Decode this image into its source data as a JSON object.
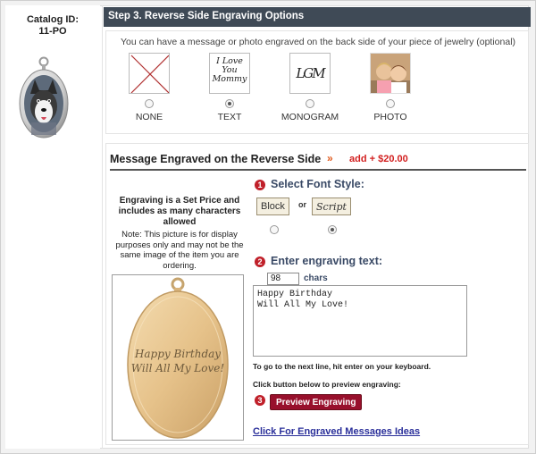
{
  "catalog": {
    "label": "Catalog ID:",
    "id": "11-PO"
  },
  "step3": {
    "title": "Step 3. Reverse Side Engraving Options",
    "intro": "You can have a message or photo engraved on the back side of your piece of jewelry (optional)",
    "options": [
      {
        "label": "NONE",
        "selected": false,
        "icon": "red-x-none-icon"
      },
      {
        "label": "TEXT",
        "selected": true,
        "sample_lines": [
          "I Love",
          "You",
          "Mommy"
        ]
      },
      {
        "label": "MONOGRAM",
        "selected": false,
        "sample": "LGM"
      },
      {
        "label": "PHOTO",
        "selected": false,
        "icon": "children-photo-icon"
      }
    ]
  },
  "message": {
    "title": "Message Engraved on the Reverse Side",
    "arrows": "»",
    "price": "add + $20.00",
    "set_price_note": "Engraving is a Set Price and includes as many characters allowed",
    "display_note": "Note: This picture is for display purposes only and may not be the same image of the item you are ordering.",
    "preview_text": [
      "Happy Birthday",
      "Will All My Love!"
    ]
  },
  "font_style": {
    "step": "1",
    "label": "Select Font Style:",
    "block_label": "Block",
    "or_text": "or",
    "script_label": "Script",
    "selected": "Script"
  },
  "engraving_text": {
    "step": "2",
    "label": "Enter engraving text:",
    "chars_value": "98",
    "chars_label": "chars",
    "value": "Happy Birthday\nWill All My Love!",
    "next_line_hint": "To go to the next line, hit enter on your keyboard.",
    "preview_hint": "Click button below to preview engraving:"
  },
  "preview": {
    "step": "3",
    "button_label": "Preview Engraving"
  },
  "ideas_link": "Click For Engraved Messages Ideas",
  "colors": {
    "header_bg": "#3f4a56",
    "accent_red": "#d21f1f",
    "button_bg": "#98102c",
    "link": "#2a2f9a"
  }
}
